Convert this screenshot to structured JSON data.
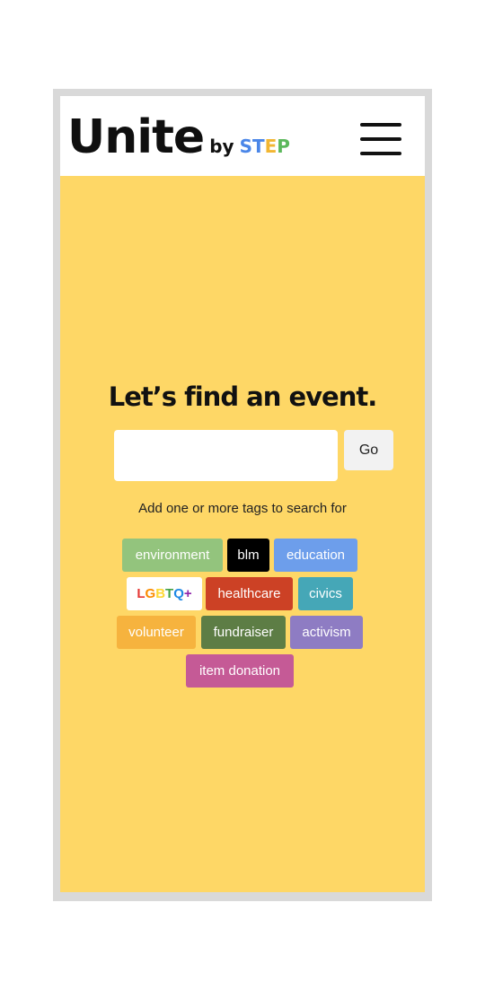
{
  "header": {
    "logo_main": "Unite",
    "logo_by": "by",
    "logo_step_letters": [
      {
        "char": "S",
        "color": "#4a86e8"
      },
      {
        "char": "T",
        "color": "#4a86e8"
      },
      {
        "char": "E",
        "color": "#f2b632"
      },
      {
        "char": "P",
        "color": "#5cb85c"
      }
    ],
    "menu_icon": "hamburger-menu-icon"
  },
  "main": {
    "title": "Let’s find an event.",
    "search_placeholder": "",
    "go_label": "Go",
    "hint": "Add one or more tags to search for"
  },
  "tags": [
    {
      "label": "environment",
      "color": "#93c47d"
    },
    {
      "label": "blm",
      "color": "#000000"
    },
    {
      "label": "education",
      "color": "#6d9eeb"
    },
    {
      "label": "LGBTQ+",
      "color": "#ffffff"
    },
    {
      "label": "healthcare",
      "color": "#cc4125"
    },
    {
      "label": "civics",
      "color": "#45a7b7"
    },
    {
      "label": "volunteer",
      "color": "#f6b33e"
    },
    {
      "label": "fundraiser",
      "color": "#5d7d45"
    },
    {
      "label": "activism",
      "color": "#8e7cc3"
    },
    {
      "label": "item donation",
      "color": "#c55a96"
    }
  ],
  "lgbtq_letters": [
    {
      "char": "L",
      "color": "#e53935"
    },
    {
      "char": "G",
      "color": "#fb8c00"
    },
    {
      "char": "B",
      "color": "#fdd835"
    },
    {
      "char": "T",
      "color": "#43a047"
    },
    {
      "char": "Q",
      "color": "#1e88e5"
    },
    {
      "char": "+",
      "color": "#8e24aa"
    }
  ]
}
